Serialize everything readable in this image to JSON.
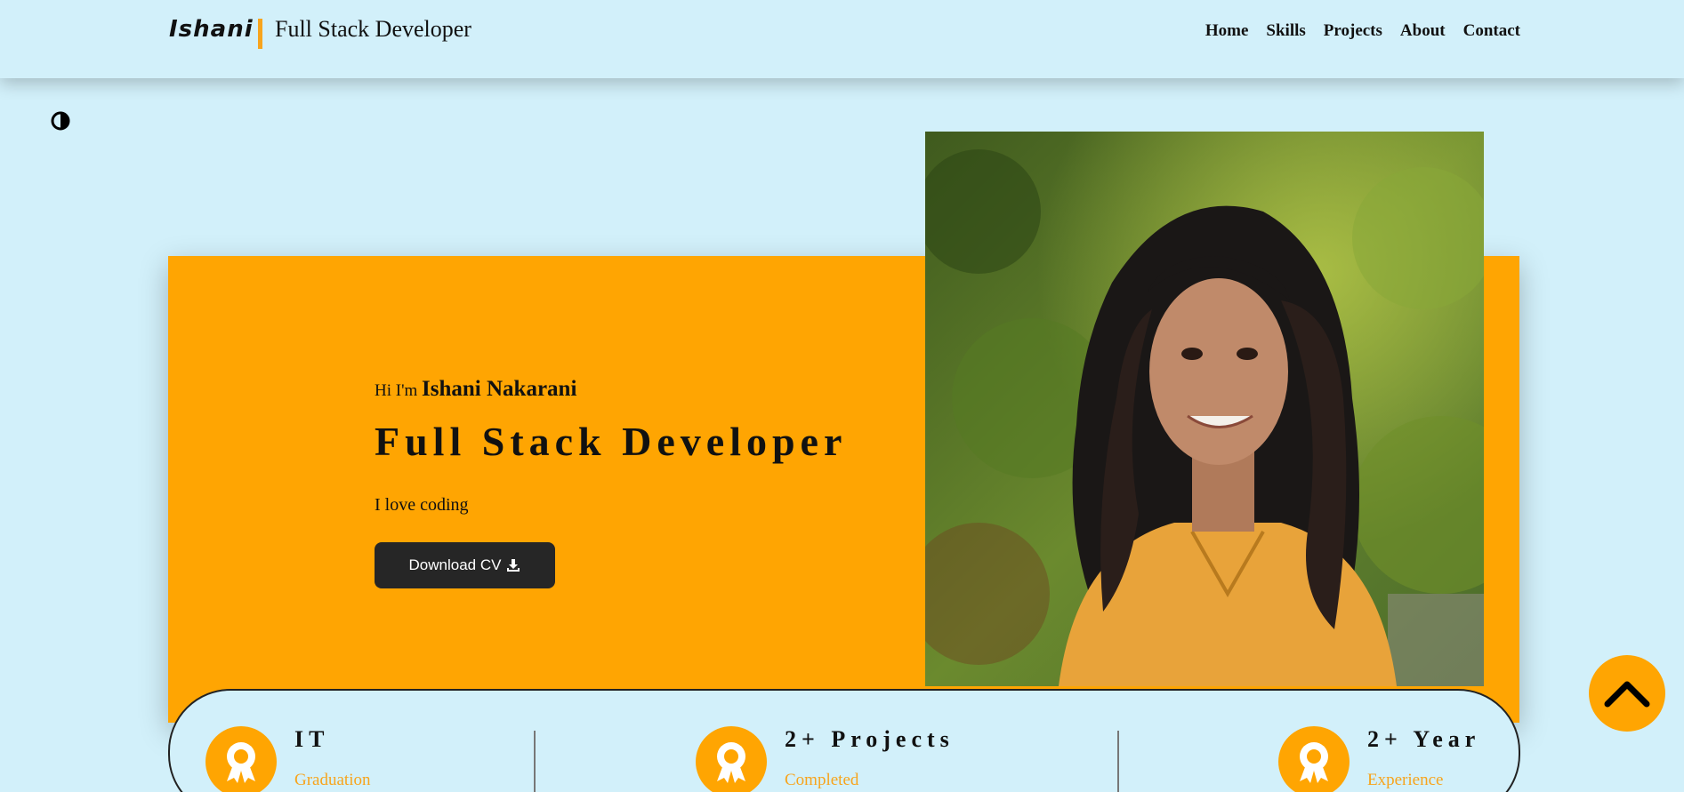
{
  "header": {
    "logo": "Ishani",
    "tagline": "Full Stack Developer",
    "nav": [
      "Home",
      "Skills",
      "Projects",
      "About",
      "Contact"
    ]
  },
  "hero": {
    "greeting": "Hi I'm",
    "name": "Ishani Nakarani",
    "role": "Full Stack Developer",
    "subtitle": "I love coding",
    "cv_button": "Download CV"
  },
  "stats": [
    {
      "title": "IT",
      "subtitle": "Graduation"
    },
    {
      "title": "2+ Projects",
      "subtitle": "Completed"
    },
    {
      "title": "2+ Year",
      "subtitle": "Experience"
    }
  ],
  "colors": {
    "background": "#d2f0fa",
    "accent": "#ffa502",
    "button": "#262626"
  },
  "icons": [
    "theme-toggle-icon",
    "download-icon",
    "award-icon",
    "chevron-up-icon"
  ]
}
